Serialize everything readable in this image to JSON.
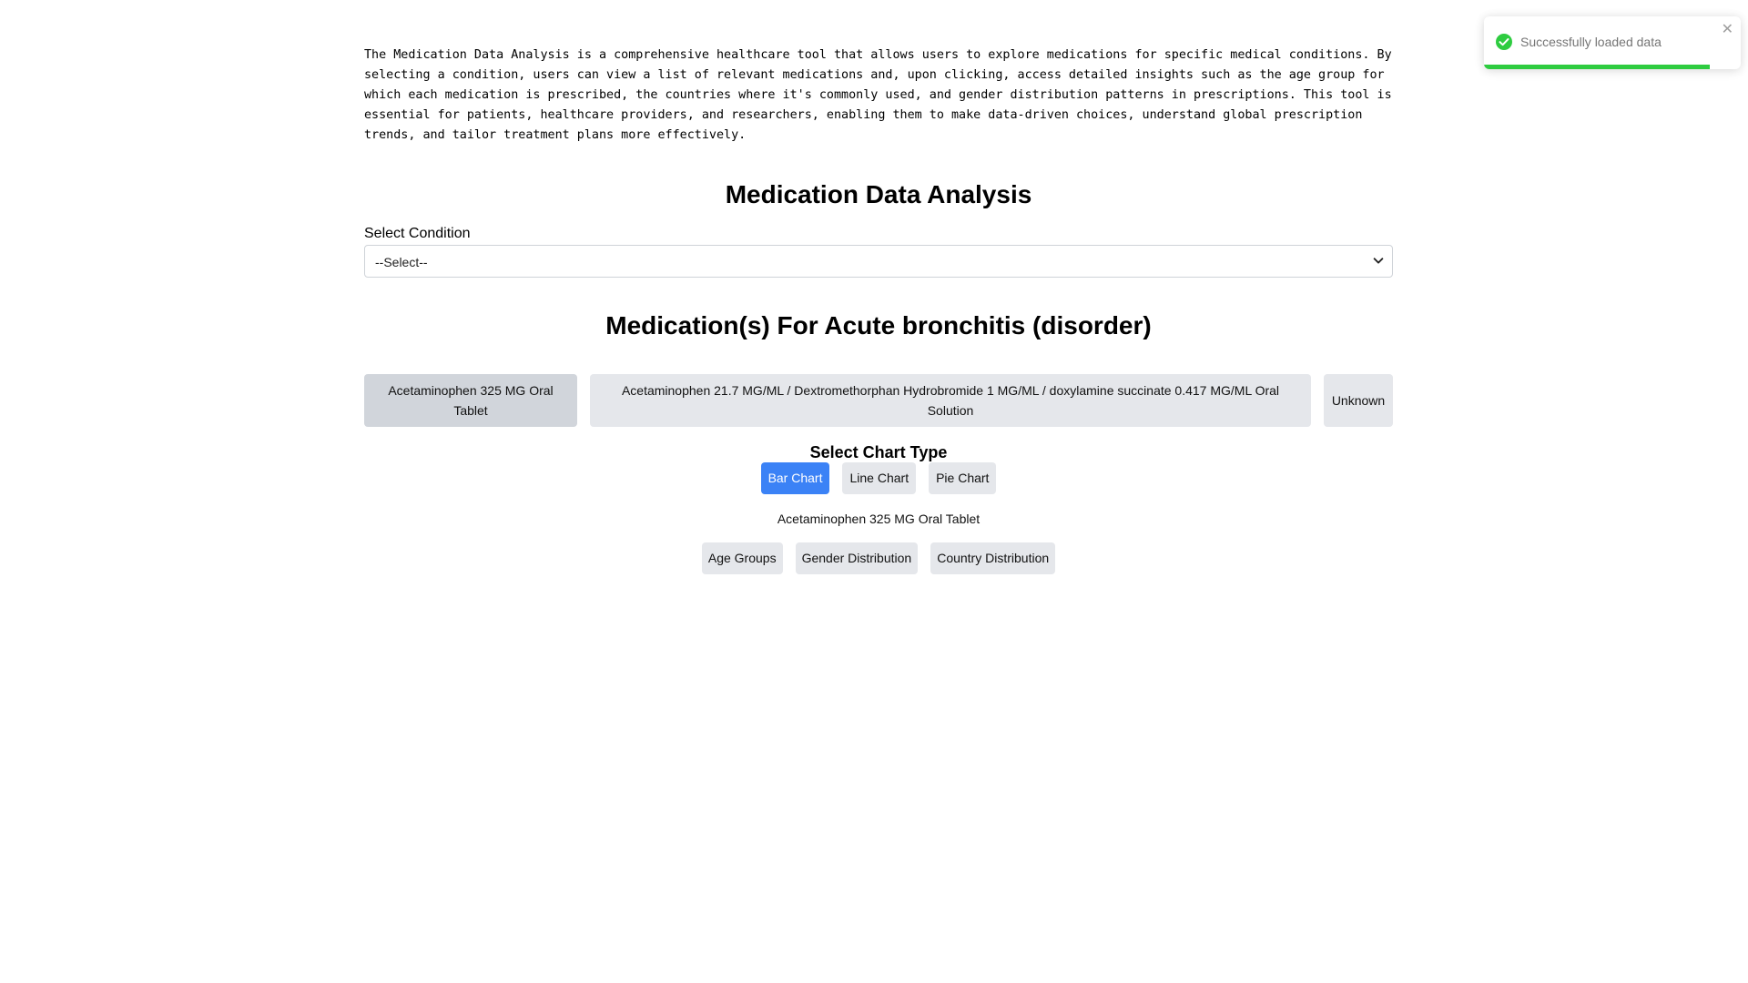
{
  "intro": {
    "text": "The Medication Data Analysis is a comprehensive healthcare tool that allows users to explore medications for specific medical conditions. By selecting a condition, users can view a list of relevant medications and, upon clicking, access detailed insights such as the age group for which each medication is prescribed, the countries where it's commonly used, and gender distribution patterns in prescriptions. This tool is essential for patients, healthcare providers, and researchers, enabling them to make data-driven choices, understand global prescription trends, and tailor treatment plans more effectively."
  },
  "page": {
    "title": "Medication Data Analysis"
  },
  "condition_select": {
    "label": "Select Condition",
    "value": "--Select--"
  },
  "medications": {
    "title": "Medication(s) For Acute bronchitis (disorder)",
    "items": [
      {
        "label": "Acetaminophen 325 MG Oral Tablet",
        "selected": true
      },
      {
        "label": "Acetaminophen 21.7 MG/ML / Dextromethorphan Hydrobromide 1 MG/ML / doxylamine succinate 0.417 MG/ML Oral Solution",
        "selected": false
      },
      {
        "label": "Unknown",
        "selected": false
      }
    ]
  },
  "chart_type": {
    "title": "Select Chart Type",
    "options": [
      "Bar Chart",
      "Line Chart",
      "Pie Chart"
    ],
    "selected": "Bar Chart"
  },
  "selected_medication": {
    "label": "Acetaminophen 325 MG Oral Tablet"
  },
  "distribution_tabs": [
    "Age Groups",
    "Gender Distribution",
    "Country Distribution"
  ],
  "toast": {
    "message": "Successfully loaded data",
    "icon": "check-circle-icon",
    "close_icon": "close-icon",
    "progress": 0.88,
    "color": "#2ecc40"
  },
  "colors": {
    "accent": "#3b82f6",
    "button_bg": "#e5e7eb",
    "button_selected_bg": "#d1d5db",
    "success": "#2ecc40"
  }
}
